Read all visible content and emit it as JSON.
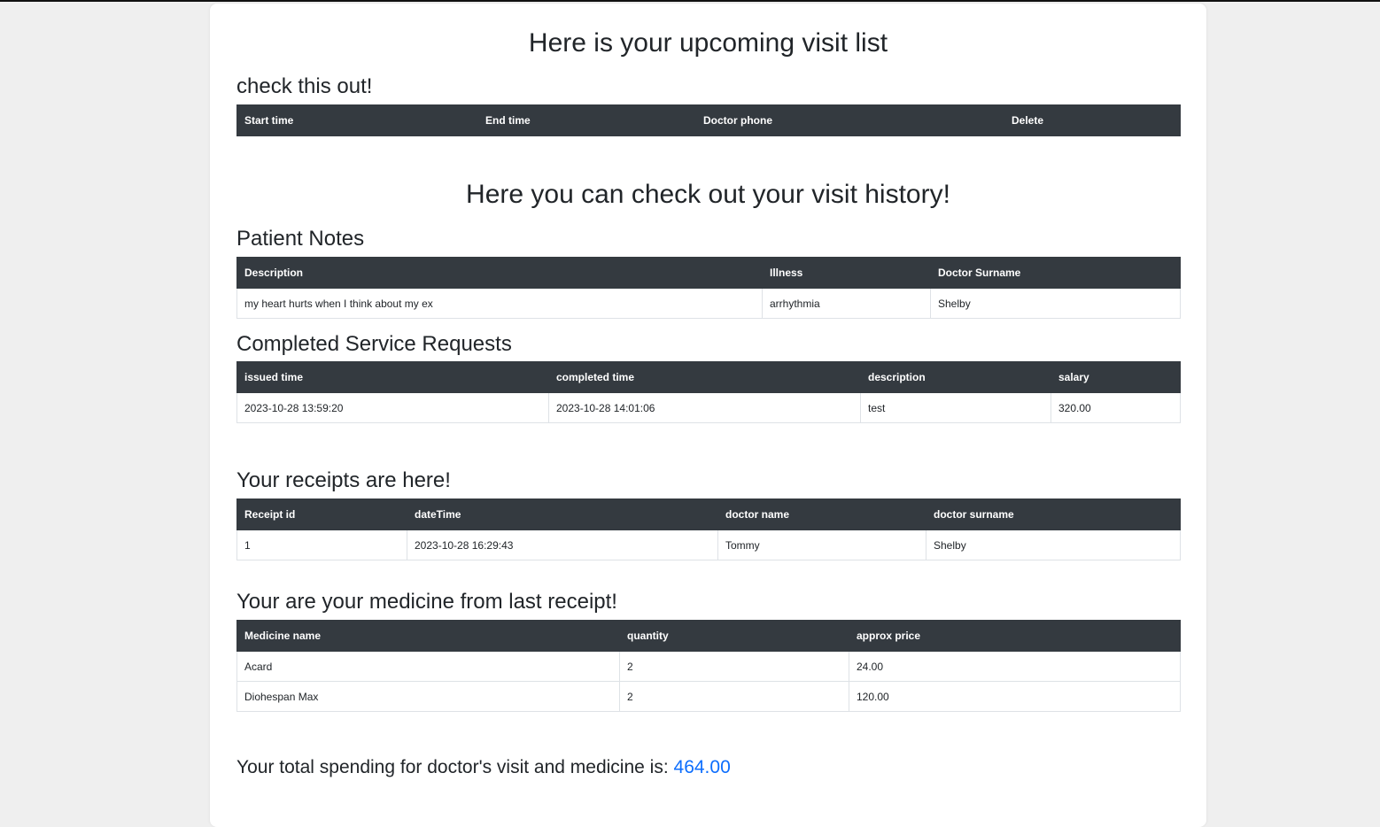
{
  "upcoming": {
    "title": "Here is your upcoming visit list",
    "subtitle": "check this out!",
    "columns": [
      "Start time",
      "End time",
      "Doctor phone",
      "Delete"
    ]
  },
  "history": {
    "title": "Here you can check out your visit history!"
  },
  "notes": {
    "title": "Patient Notes",
    "columns": [
      "Description",
      "Illness",
      "Doctor Surname"
    ],
    "rows": [
      [
        "my heart hurts when I think about my ex",
        "arrhythmia",
        "Shelby"
      ]
    ]
  },
  "services": {
    "title": "Completed Service Requests",
    "columns": [
      "issued time",
      "completed time",
      "description",
      "salary"
    ],
    "rows": [
      [
        "2023-10-28 13:59:20",
        "2023-10-28 14:01:06",
        "test",
        "320.00"
      ]
    ]
  },
  "receipts": {
    "title": "Your receipts are here!",
    "columns": [
      "Receipt id",
      "dateTime",
      "doctor name",
      "doctor surname"
    ],
    "rows": [
      [
        "1",
        "2023-10-28 16:29:43",
        "Tommy",
        "Shelby"
      ]
    ]
  },
  "medicine": {
    "title": "Your are your medicine from last receipt!",
    "columns": [
      "Medicine name",
      "quantity",
      "approx price"
    ],
    "rows": [
      [
        "Acard",
        "2",
        "24.00"
      ],
      [
        "Diohespan Max",
        "2",
        "120.00"
      ]
    ]
  },
  "total": {
    "label": "Your total spending for doctor's visit and medicine is:",
    "amount": "464.00"
  },
  "colors": {
    "header_bg": "#343a40",
    "accent": "#0d6efd",
    "page_bg": "#efefef"
  }
}
